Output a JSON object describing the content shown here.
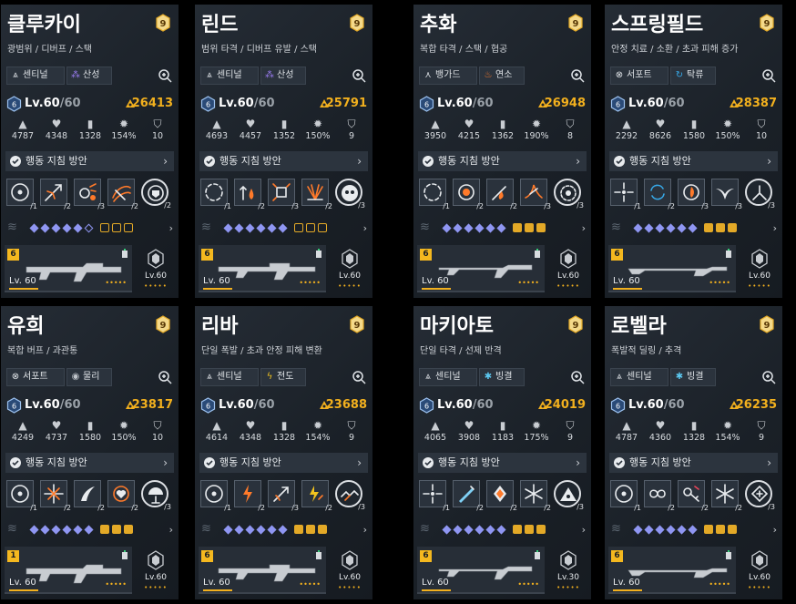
{
  "cards": [
    {
      "name": "클루카이",
      "roles": "광범위 / 디버프 / 스택",
      "grade": "9",
      "tag1": "센티널",
      "tag1_icon": "sentinel-icon",
      "tag2": "산성",
      "tag2_icon": "acid-icon",
      "level": "Lv.60",
      "level_max": "/60",
      "power": "26413",
      "stats": [
        "4787",
        "4348",
        "1328",
        "154%",
        "10"
      ],
      "guide": "행동 지침 방안",
      "skills": [
        {
          "icon": "target-ring",
          "lv": "1"
        },
        {
          "icon": "spark-arrow",
          "lv": "2"
        },
        {
          "icon": "gears-burst",
          "lv": "3"
        },
        {
          "icon": "swirl-slash",
          "lv": "2"
        },
        {
          "icon": "shield-orb",
          "lv": "2"
        }
      ],
      "potential_filled_diamonds": 5,
      "potential_filled_hex": 0,
      "weapon_grade": "6",
      "weapon_level": "Lv. 60",
      "weapon_dots": "•••••",
      "module_level": "Lv.60",
      "module_dots": "•••••"
    },
    {
      "name": "린드",
      "roles": "범위 타격 / 디버프 유발 / 스택",
      "grade": "9",
      "tag1": "센티널",
      "tag1_icon": "sentinel-icon",
      "tag2": "산성",
      "tag2_icon": "acid-icon",
      "level": "Lv.60",
      "level_max": "/60",
      "power": "25791",
      "stats": [
        "4693",
        "4457",
        "1352",
        "150%",
        "9"
      ],
      "guide": "행동 지침 방안",
      "skills": [
        {
          "icon": "dashed-ring",
          "lv": "1"
        },
        {
          "icon": "flame-arrow",
          "lv": "2"
        },
        {
          "icon": "dice-burst",
          "lv": "3"
        },
        {
          "icon": "fan-burst",
          "lv": "2"
        },
        {
          "icon": "skull-orb",
          "lv": "3"
        }
      ],
      "potential_filled_diamonds": 6,
      "potential_filled_hex": 0,
      "weapon_grade": "6",
      "weapon_level": "Lv. 60",
      "weapon_dots": "•••••",
      "module_level": "Lv.60",
      "module_dots": "•••••"
    },
    {
      "name": "추화",
      "roles": "복합 타격 / 스택 / 협공",
      "grade": "9",
      "tag1": "뱅가드",
      "tag1_icon": "vanguard-icon",
      "tag2": "연소",
      "tag2_icon": "burn-icon",
      "level": "Lv.60",
      "level_max": "/60",
      "power": "26948",
      "stats": [
        "3950",
        "4215",
        "1362",
        "190%",
        "8"
      ],
      "guide": "행동 지침 방안",
      "skills": [
        {
          "icon": "dashed-ring",
          "lv": "1"
        },
        {
          "icon": "fire-target",
          "lv": "2"
        },
        {
          "icon": "fire-slash",
          "lv": "2"
        },
        {
          "icon": "fire-wing",
          "lv": "3"
        },
        {
          "icon": "gear-orb",
          "lv": "3"
        }
      ],
      "potential_filled_diamonds": 6,
      "potential_filled_hex": 3,
      "weapon_grade": "6",
      "weapon_level": "Lv. 60",
      "weapon_dots": "•••••",
      "module_level": "Lv.60",
      "module_dots": "•••••"
    },
    {
      "name": "스프링필드",
      "roles": "안정 치료 / 소환 / 초과 피해 증가",
      "grade": "9",
      "tag1": "서포트",
      "tag1_icon": "support-icon",
      "tag2": "탁류",
      "tag2_icon": "turbid-icon",
      "level": "Lv.60",
      "level_max": "/60",
      "power": "28387",
      "stats": [
        "2292",
        "8626",
        "1580",
        "150%",
        "10"
      ],
      "guide": "행동 지침 방안",
      "skills": [
        {
          "icon": "crosshair",
          "lv": "1"
        },
        {
          "icon": "cycle",
          "lv": "2"
        },
        {
          "icon": "ring-flame",
          "lv": "3"
        },
        {
          "icon": "wing",
          "lv": "3"
        },
        {
          "icon": "tri-arrow",
          "lv": "3"
        }
      ],
      "potential_filled_diamonds": 6,
      "potential_filled_hex": 3,
      "weapon_grade": "6",
      "weapon_level": "Lv. 60",
      "weapon_dots": "•••••",
      "module_level": "Lv.60",
      "module_dots": "•••••"
    },
    {
      "name": "유희",
      "roles": "복합 버프 / 과관통",
      "grade": "9",
      "tag1": "서포트",
      "tag1_icon": "support-icon",
      "tag2": "물리",
      "tag2_icon": "physical-icon",
      "level": "Lv.60",
      "level_max": "/60",
      "power": "23817",
      "stats": [
        "4249",
        "4737",
        "1580",
        "150%",
        "10"
      ],
      "guide": "행동 지침 방안",
      "skills": [
        {
          "icon": "target-ring",
          "lv": "1"
        },
        {
          "icon": "crosshair-spark",
          "lv": "2"
        },
        {
          "icon": "claw",
          "lv": "2"
        },
        {
          "icon": "heart-ring",
          "lv": "2"
        },
        {
          "icon": "lamp",
          "lv": "3"
        }
      ],
      "potential_filled_diamonds": 6,
      "potential_filled_hex": 3,
      "weapon_grade": "1",
      "weapon_level": "Lv. 60",
      "weapon_dots": "•••••",
      "module_level": "Lv.60",
      "module_dots": "•••••"
    },
    {
      "name": "리바",
      "roles": "단일 폭발 / 초과 안정 피해 변환",
      "grade": "9",
      "tag1": "센티널",
      "tag1_icon": "sentinel-icon",
      "tag2": "전도",
      "tag2_icon": "electric-icon",
      "level": "Lv.60",
      "level_max": "/60",
      "power": "23688",
      "stats": [
        "4614",
        "4348",
        "1328",
        "154%",
        "9"
      ],
      "guide": "행동 지침 방안",
      "skills": [
        {
          "icon": "target-ring",
          "lv": "1"
        },
        {
          "icon": "fire-bolt",
          "lv": "2"
        },
        {
          "icon": "fire-arrow",
          "lv": "3"
        },
        {
          "icon": "bolt-arrow",
          "lv": "2"
        },
        {
          "icon": "chain",
          "lv": "3"
        }
      ],
      "potential_filled_diamonds": 6,
      "potential_filled_hex": 3,
      "weapon_grade": "6",
      "weapon_level": "Lv. 60",
      "weapon_dots": "•••••",
      "module_level": "Lv.60",
      "module_dots": "•••••"
    },
    {
      "name": "마키아토",
      "roles": "단일 타격 / 선제 반격",
      "grade": "9",
      "tag1": "센티널",
      "tag1_icon": "sentinel-icon",
      "tag2": "빙결",
      "tag2_icon": "frost-icon",
      "level": "Lv.60",
      "level_max": "/60",
      "power": "24019",
      "stats": [
        "4065",
        "3908",
        "1183",
        "175%",
        "9"
      ],
      "guide": "행동 지침 방안",
      "skills": [
        {
          "icon": "crosshair",
          "lv": "1"
        },
        {
          "icon": "ice-blade",
          "lv": "2"
        },
        {
          "icon": "diamond-drop",
          "lv": "2"
        },
        {
          "icon": "snowflake",
          "lv": "2"
        },
        {
          "icon": "tri-dots",
          "lv": "3"
        }
      ],
      "potential_filled_diamonds": 6,
      "potential_filled_hex": 3,
      "weapon_grade": "6",
      "weapon_level": "Lv. 60",
      "weapon_dots": "•••••",
      "module_level": "Lv.30",
      "module_dots": "•••••"
    },
    {
      "name": "로벨라",
      "roles": "폭발적 딜링 / 추격",
      "grade": "9",
      "tag1": "센티널",
      "tag1_icon": "sentinel-icon",
      "tag2": "빙결",
      "tag2_icon": "frost-icon",
      "level": "Lv.60",
      "level_max": "/60",
      "power": "26235",
      "stats": [
        "4787",
        "4360",
        "1328",
        "154%",
        "9"
      ],
      "guide": "행동 지침 방안",
      "skills": [
        {
          "icon": "target-ring",
          "lv": "1"
        },
        {
          "icon": "infinity",
          "lv": "2"
        },
        {
          "icon": "key-burst",
          "lv": "2"
        },
        {
          "icon": "snowflake",
          "lv": "2"
        },
        {
          "icon": "plus-arrow",
          "lv": "3"
        }
      ],
      "potential_filled_diamonds": 6,
      "potential_filled_hex": 3,
      "weapon_grade": "6",
      "weapon_level": "Lv. 60",
      "weapon_dots": "•••••",
      "module_level": "Lv.60",
      "module_dots": "•••••"
    }
  ],
  "colors": {
    "accent": "#f2b01e",
    "card_bg": "#1b2128",
    "potential": "#8f96f2"
  }
}
